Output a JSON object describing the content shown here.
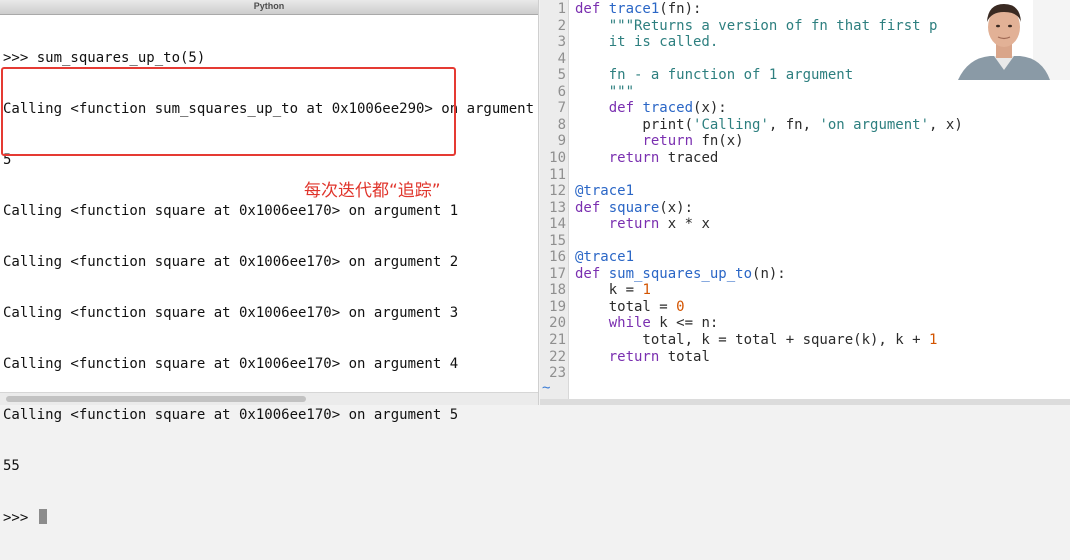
{
  "terminal": {
    "title": "Python",
    "lines": [
      ">>> sum_squares_up_to(5)",
      "Calling <function sum_squares_up_to at 0x1006ee290> on argument",
      "5",
      "Calling <function square at 0x1006ee170> on argument 1",
      "Calling <function square at 0x1006ee170> on argument 2",
      "Calling <function square at 0x1006ee170> on argument 3",
      "Calling <function square at 0x1006ee170> on argument 4",
      "Calling <function square at 0x1006ee170> on argument 5",
      "55",
      ">>> "
    ]
  },
  "annotation": "每次迭代都“追踪”",
  "editor": {
    "lines": [
      {
        "n": "1",
        "t": [
          [
            "kw",
            "def "
          ],
          [
            "fn",
            "trace1"
          ],
          [
            "pl",
            "(fn):"
          ]
        ]
      },
      {
        "n": "2",
        "t": [
          [
            "str",
            "    \"\"\"Returns a version of fn that first pri"
          ]
        ]
      },
      {
        "n": "3",
        "t": [
          [
            "str",
            "    it is called."
          ]
        ]
      },
      {
        "n": "4",
        "t": []
      },
      {
        "n": "5",
        "t": [
          [
            "str",
            "    fn - a function of 1 argument"
          ]
        ]
      },
      {
        "n": "6",
        "t": [
          [
            "str",
            "    \"\"\""
          ]
        ]
      },
      {
        "n": "7",
        "t": [
          [
            "pl",
            "    "
          ],
          [
            "kw",
            "def "
          ],
          [
            "fn",
            "traced"
          ],
          [
            "pl",
            "(x):"
          ]
        ]
      },
      {
        "n": "8",
        "t": [
          [
            "pl",
            "        print("
          ],
          [
            "str",
            "'Calling'"
          ],
          [
            "pl",
            ", fn, "
          ],
          [
            "str",
            "'on argument'"
          ],
          [
            "pl",
            ", x)"
          ]
        ]
      },
      {
        "n": "9",
        "t": [
          [
            "pl",
            "        "
          ],
          [
            "kw",
            "return "
          ],
          [
            "pl",
            "fn(x)"
          ]
        ]
      },
      {
        "n": "10",
        "t": [
          [
            "pl",
            "    "
          ],
          [
            "kw",
            "return "
          ],
          [
            "pl",
            "traced"
          ]
        ]
      },
      {
        "n": "11",
        "t": []
      },
      {
        "n": "12",
        "t": [
          [
            "dec",
            "@trace1"
          ]
        ]
      },
      {
        "n": "13",
        "t": [
          [
            "kw",
            "def "
          ],
          [
            "fn",
            "square"
          ],
          [
            "pl",
            "(x):"
          ]
        ]
      },
      {
        "n": "14",
        "t": [
          [
            "pl",
            "    "
          ],
          [
            "kw",
            "return "
          ],
          [
            "pl",
            "x * x"
          ]
        ]
      },
      {
        "n": "15",
        "t": []
      },
      {
        "n": "16",
        "t": [
          [
            "dec",
            "@trace1"
          ]
        ]
      },
      {
        "n": "17",
        "t": [
          [
            "kw",
            "def "
          ],
          [
            "fn",
            "sum_squares_up_to"
          ],
          [
            "pl",
            "(n):"
          ]
        ]
      },
      {
        "n": "18",
        "t": [
          [
            "pl",
            "    k = "
          ],
          [
            "num",
            "1"
          ]
        ]
      },
      {
        "n": "19",
        "t": [
          [
            "pl",
            "    total = "
          ],
          [
            "num",
            "0"
          ]
        ]
      },
      {
        "n": "20",
        "t": [
          [
            "pl",
            "    "
          ],
          [
            "kw",
            "while "
          ],
          [
            "pl",
            "k <= n:"
          ]
        ]
      },
      {
        "n": "21",
        "t": [
          [
            "pl",
            "        total, k = total + square(k), k + "
          ],
          [
            "num",
            "1"
          ]
        ]
      },
      {
        "n": "22",
        "t": [
          [
            "pl",
            "    "
          ],
          [
            "kw",
            "return "
          ],
          [
            "pl",
            "total"
          ]
        ]
      },
      {
        "n": "23",
        "t": []
      }
    ],
    "tilde": "~"
  },
  "webcam": {
    "icon": "person-video-icon"
  }
}
